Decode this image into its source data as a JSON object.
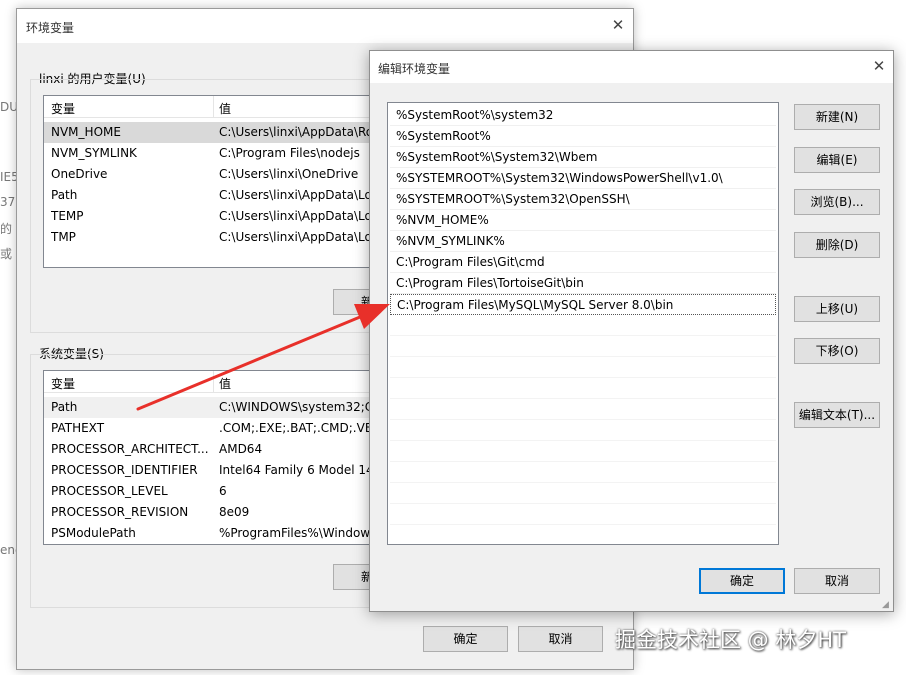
{
  "background_fragments": [
    "DU",
    "IE5",
    "37",
    "的",
    "或",
    "enc"
  ],
  "env_dialog": {
    "title": "环境变量",
    "user_group_label": "linxi 的用户变量(U)",
    "system_group_label": "系统变量(S)",
    "columns": {
      "name": "变量",
      "value": "值"
    },
    "user_vars": [
      {
        "name": "NVM_HOME",
        "value": "C:\\Users\\linxi\\AppData\\Ro"
      },
      {
        "name": "NVM_SYMLINK",
        "value": "C:\\Program Files\\nodejs"
      },
      {
        "name": "OneDrive",
        "value": "C:\\Users\\linxi\\OneDrive"
      },
      {
        "name": "Path",
        "value": "C:\\Users\\linxi\\AppData\\Lo"
      },
      {
        "name": "TEMP",
        "value": "C:\\Users\\linxi\\AppData\\Lo"
      },
      {
        "name": "TMP",
        "value": "C:\\Users\\linxi\\AppData\\Lo"
      }
    ],
    "system_vars": [
      {
        "name": "Path",
        "value": "C:\\WINDOWS\\system32;C"
      },
      {
        "name": "PATHEXT",
        "value": ".COM;.EXE;.BAT;.CMD;.VBS"
      },
      {
        "name": "PROCESSOR_ARCHITECT...",
        "value": "AMD64"
      },
      {
        "name": "PROCESSOR_IDENTIFIER",
        "value": "Intel64 Family 6 Model 14"
      },
      {
        "name": "PROCESSOR_LEVEL",
        "value": "6"
      },
      {
        "name": "PROCESSOR_REVISION",
        "value": "8e09"
      },
      {
        "name": "PSModulePath",
        "value": "%ProgramFiles%\\Window"
      }
    ],
    "user_new_button": "新建",
    "system_new_button": "新建",
    "ok_button": "确定",
    "cancel_button": "取消"
  },
  "edit_dialog": {
    "title": "编辑环境变量",
    "paths": [
      "%SystemRoot%\\system32",
      "%SystemRoot%",
      "%SystemRoot%\\System32\\Wbem",
      "%SYSTEMROOT%\\System32\\WindowsPowerShell\\v1.0\\",
      "%SYSTEMROOT%\\System32\\OpenSSH\\",
      "%NVM_HOME%",
      "%NVM_SYMLINK%",
      "C:\\Program Files\\Git\\cmd",
      "C:\\Program Files\\TortoiseGit\\bin",
      "C:\\Program Files\\MySQL\\MySQL Server 8.0\\bin"
    ],
    "buttons": {
      "new": "新建(N)",
      "edit": "编辑(E)",
      "browse": "浏览(B)...",
      "delete": "删除(D)",
      "move_up": "上移(U)",
      "move_down": "下移(O)",
      "edit_text": "编辑文本(T)...",
      "ok": "确定",
      "cancel": "取消"
    }
  },
  "watermark": "掘金技术社区 @ 林夕HT",
  "colors": {
    "arrow": "#e8302a",
    "focus_border": "#0078d7",
    "selection": "#d9d9d9"
  }
}
